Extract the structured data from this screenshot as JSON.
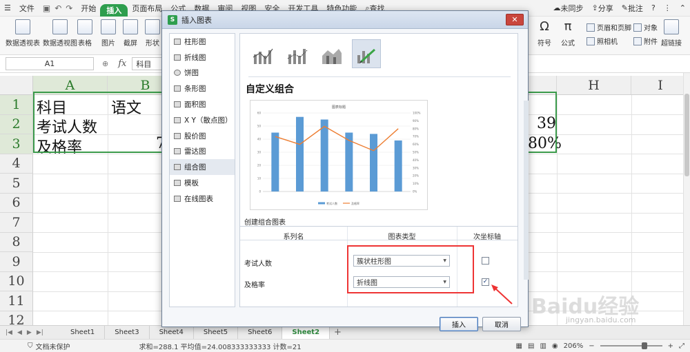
{
  "menubar": {
    "file": "文件",
    "tabs": [
      "开始",
      "插入",
      "页面布局",
      "公式",
      "数据",
      "审阅",
      "视图",
      "安全",
      "开发工具",
      "特色功能"
    ],
    "active_tab": "插入",
    "search": "查找",
    "unsynced": "未同步",
    "share": "分享",
    "comment": "批注"
  },
  "ribbon": {
    "items": [
      "数据透视表",
      "数据透视图",
      "表格",
      "图片",
      "截屏",
      "形状"
    ],
    "right_items": [
      "符号",
      "公式"
    ],
    "small": [
      "页眉和页脚",
      "对象",
      "照相机",
      "附件"
    ],
    "hyperlink": "超链接"
  },
  "formula_bar": {
    "cell_ref": "A1",
    "fx": "fx",
    "value": "科目"
  },
  "sheet": {
    "columns": [
      "A",
      "B",
      "H",
      "I"
    ],
    "rows": [
      "1",
      "2",
      "3",
      "4",
      "5",
      "6",
      "7",
      "8",
      "9",
      "10",
      "11",
      "12"
    ],
    "cells": {
      "a1": "科目",
      "b1": "语文",
      "a2": "考试人数",
      "a3": "及格率",
      "b3_partial": "7",
      "g2": "39",
      "g3": "80%"
    }
  },
  "sheet_tabs": [
    "Sheet1",
    "Sheet3",
    "Sheet4",
    "Sheet5",
    "Sheet6",
    "Sheet2"
  ],
  "active_sheet": "Sheet2",
  "status": {
    "protect": "文档未保护",
    "summary": "求和=288.1  平均值=24.008333333333  计数=21",
    "zoom": "206%"
  },
  "dialog": {
    "title": "插入图表",
    "close": "✕",
    "chart_types": [
      "柱形图",
      "折线图",
      "饼图",
      "条形图",
      "面积图",
      "X Y（散点图）",
      "股价图",
      "雷达图",
      "组合图",
      "模板",
      "在线图表"
    ],
    "selected_type": "组合图",
    "section_title": "自定义组合",
    "preview": {
      "title": "图表标题",
      "legend": [
        "考试人数",
        "及格率"
      ],
      "colors": {
        "bar": "#5b9bd5",
        "line": "#ed7d31"
      }
    },
    "config_title": "创建组合图表",
    "table_headers": [
      "系列名",
      "图表类型",
      "次坐标轴"
    ],
    "series": [
      {
        "name": "考试人数",
        "type": "簇状柱形图",
        "secondary": ""
      },
      {
        "name": "及格率",
        "type": "折线图",
        "secondary": "✓"
      }
    ],
    "insert_btn": "插入",
    "cancel_btn": "取消"
  },
  "chart_data": {
    "type": "bar",
    "title": "图表标题",
    "categories": [
      "",
      "",
      "",
      "",
      "",
      ""
    ],
    "series": [
      {
        "name": "考试人数",
        "type": "bar",
        "values": [
          45,
          57,
          55,
          45,
          44,
          39
        ]
      },
      {
        "name": "及格率",
        "type": "line",
        "axis": "secondary",
        "values": [
          0.7,
          0.6,
          0.83,
          0.65,
          0.52,
          0.8
        ]
      }
    ],
    "ylim": [
      0,
      60
    ],
    "y2lim": [
      0,
      1.0
    ],
    "y_ticks": [
      "0",
      "10",
      "20",
      "30",
      "40",
      "50",
      "60"
    ],
    "y2_ticks": [
      "0%",
      "10%",
      "20%",
      "30%",
      "40%",
      "50%",
      "60%",
      "70%",
      "80%",
      "90%",
      "100%"
    ],
    "legend": "bottom"
  },
  "watermark": {
    "brand": "Baidu经验",
    "url": "jingyan.baidu.com"
  }
}
